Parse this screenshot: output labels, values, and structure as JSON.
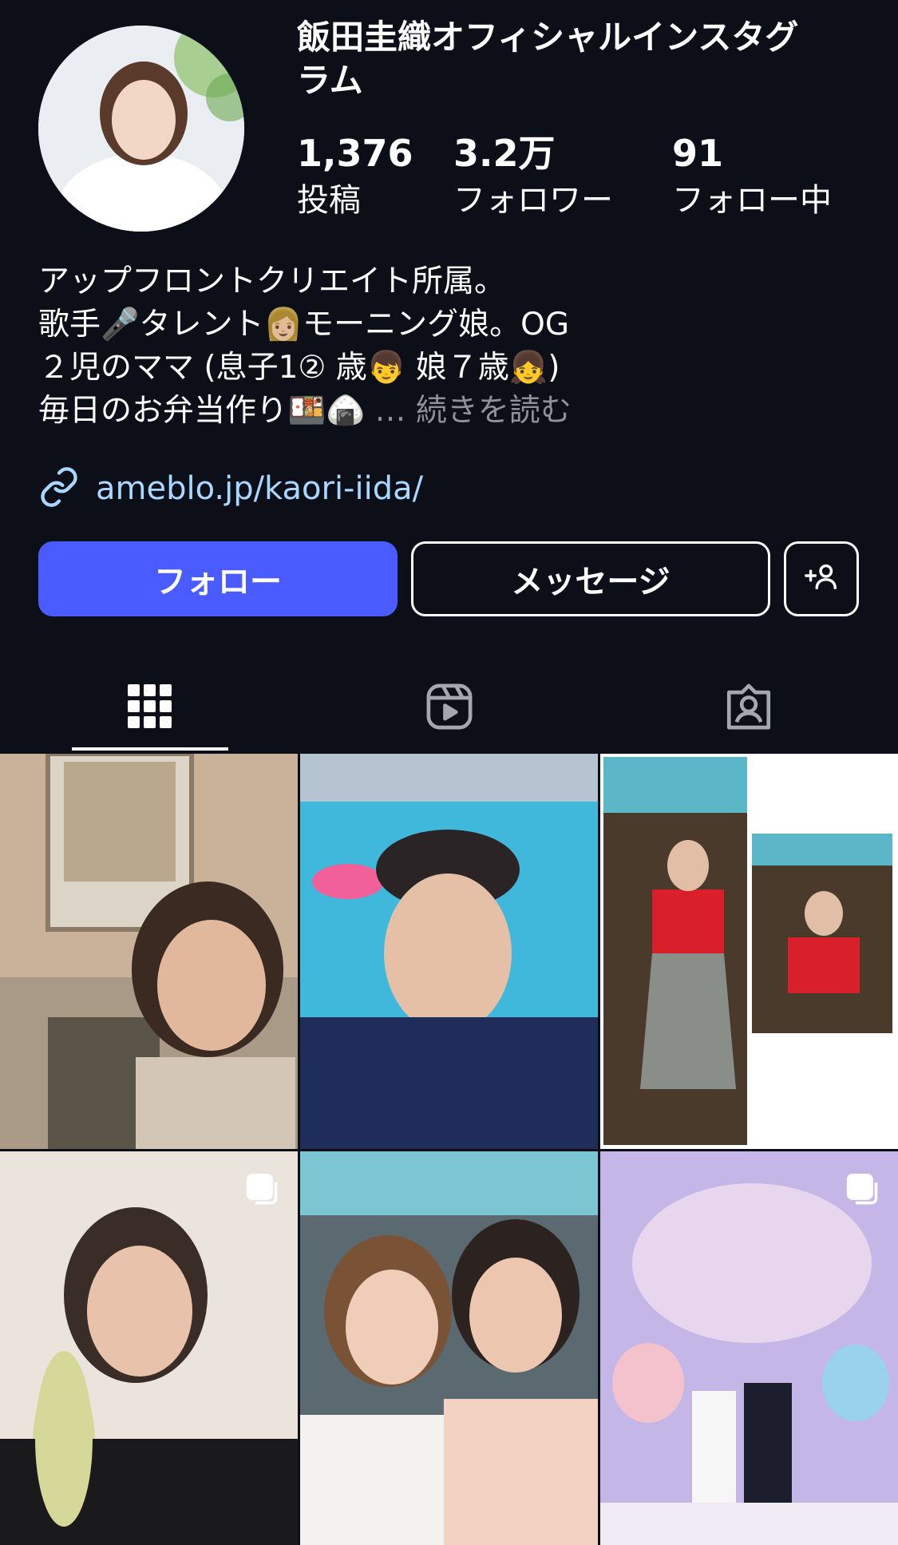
{
  "profile": {
    "name_line1": "飯田圭織オフィシャルインスタグ",
    "name_line2": "ラム",
    "stats": [
      {
        "value": "1,376",
        "label": "投稿"
      },
      {
        "value": "3.2万",
        "label": "フォロワー"
      },
      {
        "value": "91",
        "label": "フォロー中"
      }
    ],
    "bio": [
      "アップフロントクリエイト所属。",
      "歌手🎤タレント👩🏼モーニング娘。OG",
      "２児のママ (息子1② 歳👦 娘７歳👧)",
      "毎日のお弁当作り🍱🍙"
    ],
    "more_label": "… 続きを読む",
    "link": "ameblo.jp/kaori-iida/"
  },
  "actions": {
    "follow": "フォロー",
    "message": "メッセージ",
    "add_user": "+👤"
  },
  "tabs": [
    {
      "name": "posts",
      "icon": "grid-icon"
    },
    {
      "name": "reels",
      "icon": "reels-icon"
    },
    {
      "name": "tagged",
      "icon": "tagged-icon"
    }
  ],
  "posts": [
    {
      "description": "selfie with movie poster",
      "multi": false
    },
    {
      "description": "pool selfie with visor",
      "multi": false
    },
    {
      "description": "red top gray dress",
      "multi": false
    },
    {
      "description": "holding corn",
      "multi": true
    },
    {
      "description": "two women peace sign",
      "multi": false
    },
    {
      "description": "characters photo spot",
      "multi": true
    }
  ]
}
